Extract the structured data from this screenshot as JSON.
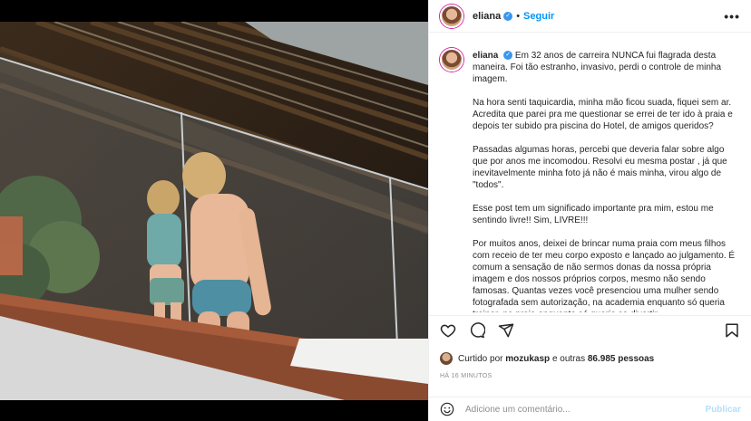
{
  "post": {
    "username": "eliana",
    "follow_label": "Seguir",
    "dot": "•",
    "more_label": "•••",
    "verified_mark": "✓"
  },
  "caption": {
    "username": "eliana",
    "paragraphs": [
      "Em 32 anos de carreira NUNCA fui flagrada desta maneira. Foi tão estranho, invasivo, perdi o controle de minha imagem.",
      "Na hora senti taquicardia, minha mão ficou suada, fiquei sem ar. Acredita que parei pra me questionar se errei de ter ido à praia e depois ter subido pra piscina do Hotel, de amigos queridos?",
      "Passadas algumas horas, percebi que deveria falar sobre algo que por anos me incomodou. Resolvi eu mesma postar , já que inevitavelmente minha foto já não é mais minha, virou algo de \"todos\".",
      "Esse post tem um significado importante pra mim, estou me sentindo livre!! Sim, LIVRE!!!",
      "Por muitos anos, deixei de brincar numa praia com meus filhos com receio de ter meu corpo exposto e lançado ao julgamento. É comum a sensação de não sermos donas da nossa própria imagem e dos nossos próprios corpos, mesmo não sendo famosas. Quantas vezes você presenciou uma mulher sendo fotografada sem autorização, na academia enquanto só queria treinar, na praia enquanto só queria se divertir..."
    ]
  },
  "likes": {
    "prefix": "Curtido por",
    "user": "mozukasp",
    "middle": "e outras",
    "count": "86.985 pessoas"
  },
  "timestamp": "HÁ 16 MINUTOS",
  "comment": {
    "placeholder": "Adicione um comentário...",
    "publish_label": "Publicar"
  },
  "icons": [
    "heart-icon",
    "comment-icon",
    "share-icon",
    "bookmark-icon",
    "emoji-icon",
    "verified-icon"
  ],
  "colors": {
    "accent": "#0095f6",
    "publish_disabled": "#b2dffc",
    "verified": "#3897f0"
  }
}
